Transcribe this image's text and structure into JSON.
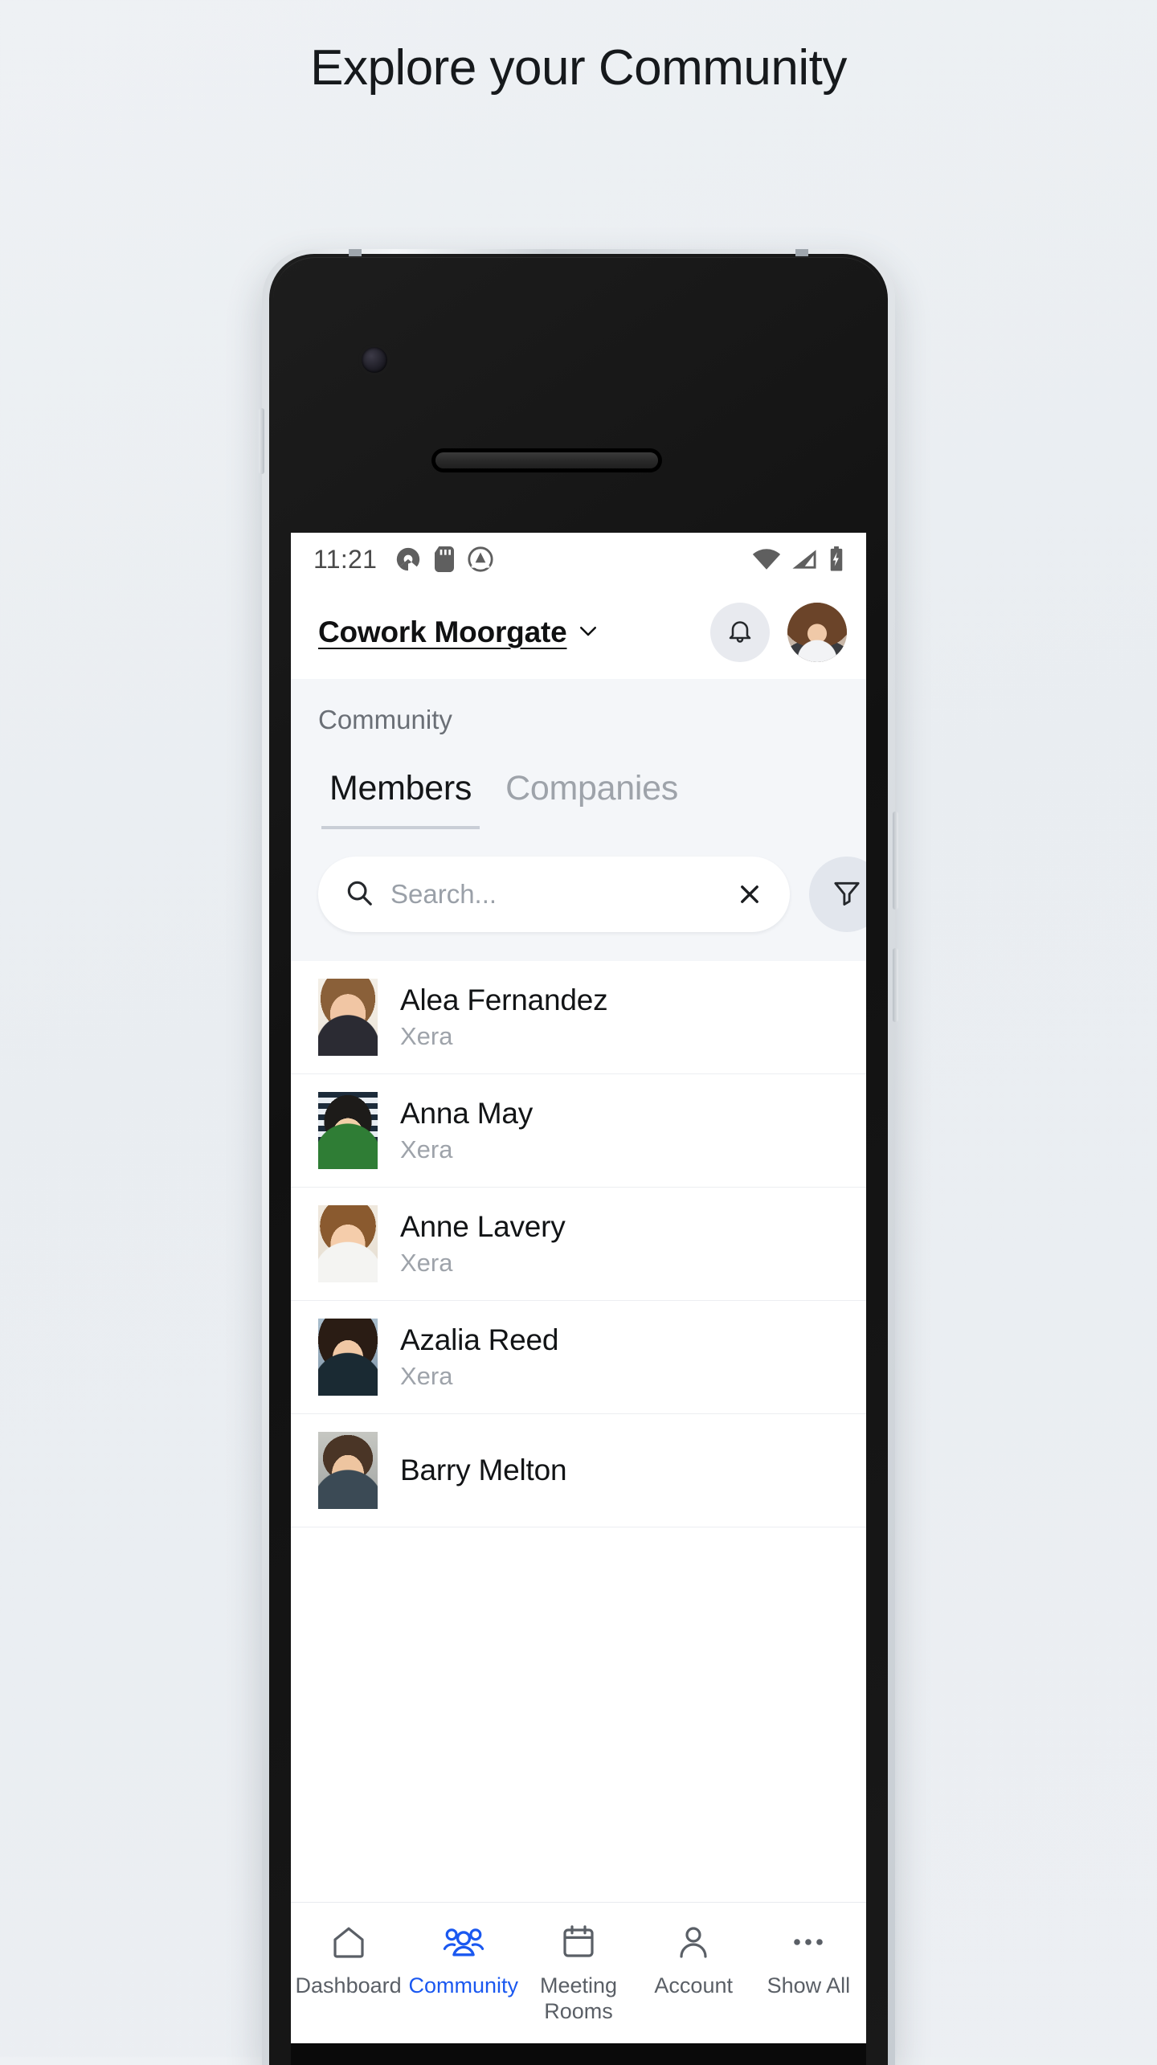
{
  "page": {
    "heading": "Explore your Community"
  },
  "status_bar": {
    "time": "11:21",
    "left_icons": [
      "app-notification-icon",
      "sd-card-icon",
      "adblock-icon"
    ],
    "right_icons": [
      "wifi-icon",
      "cellular-signal-icon",
      "battery-charging-icon"
    ]
  },
  "app_header": {
    "site_name": "Cowork Moorgate",
    "chevron_icon": "chevron-down-icon",
    "bell_icon": "bell-icon",
    "avatar_icon": "user-avatar"
  },
  "section": {
    "title": "Community",
    "tabs": [
      {
        "label": "Members",
        "active": true
      },
      {
        "label": "Companies",
        "active": false
      }
    ]
  },
  "search": {
    "placeholder": "Search...",
    "value": "",
    "search_icon": "search-icon",
    "clear_icon": "close-icon",
    "filter_icon": "filter-icon"
  },
  "members": [
    {
      "name": "Alea Fernandez",
      "company": "Xera"
    },
    {
      "name": "Anna May",
      "company": "Xera"
    },
    {
      "name": "Anne Lavery",
      "company": "Xera"
    },
    {
      "name": "Azalia Reed",
      "company": "Xera"
    },
    {
      "name": "Barry Melton",
      "company": ""
    }
  ],
  "bottom_nav": [
    {
      "label": "Dashboard",
      "icon": "home-icon",
      "active": false
    },
    {
      "label": "Community",
      "icon": "people-icon",
      "active": true
    },
    {
      "label": "Meeting\nRooms",
      "icon": "calendar-icon",
      "active": false
    },
    {
      "label": "Account",
      "icon": "person-icon",
      "active": false
    },
    {
      "label": "Show All",
      "icon": "ellipsis-icon",
      "active": false
    }
  ],
  "colors": {
    "accent": "#1a58f0",
    "page_bg": "#eef1f4",
    "section_bg": "#f4f6f9",
    "text_primary": "#121416",
    "text_muted": "#9ea3aa"
  }
}
